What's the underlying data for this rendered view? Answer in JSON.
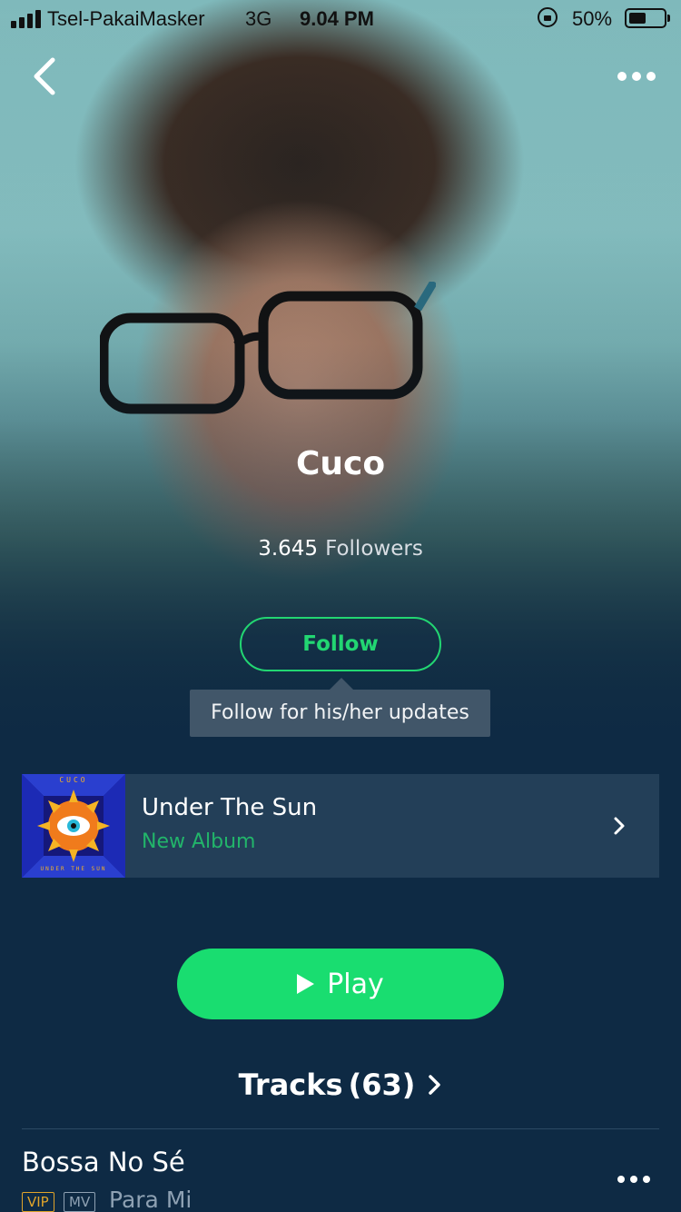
{
  "status_bar": {
    "carrier": "Tsel-PakaiMasker",
    "network": "3G",
    "time": "9.04 PM",
    "battery": "50%"
  },
  "header": {
    "back_icon": "chevron-left-icon",
    "more_icon": "more-dots-icon"
  },
  "artist": {
    "name": "Cuco",
    "followers_count": "3.645",
    "followers_label": "Followers",
    "follow_label": "Follow",
    "tooltip": "Follow for his/her updates"
  },
  "album_card": {
    "title": "Under The Sun",
    "subtitle": "New Album",
    "art_top_text": "CUCO",
    "art_bottom_text": "UNDER THE SUN"
  },
  "play_button": {
    "label": "Play",
    "icon": "play-icon"
  },
  "tracks": {
    "label": "Tracks",
    "count": "(63)",
    "items": [
      {
        "title": "Bossa No Sé",
        "badges": [
          "VIP",
          "MV"
        ],
        "subtitle": "Para Mi"
      }
    ]
  },
  "colors": {
    "accent_green": "#19dd70",
    "background": "#0e2a44",
    "vip_badge": "#e0a42a"
  }
}
